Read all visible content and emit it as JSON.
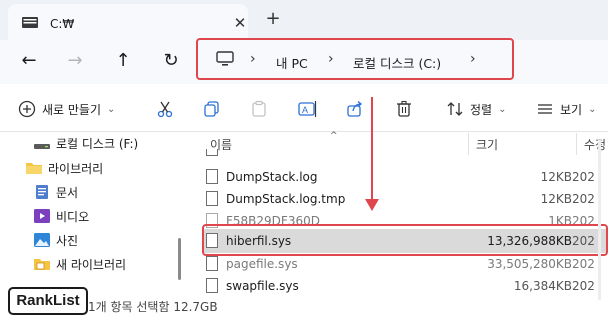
{
  "tab": {
    "title": "C:₩",
    "close_glyph": "✕",
    "new_tab_glyph": "+"
  },
  "nav": {
    "back": "←",
    "forward": "→",
    "up": "↑",
    "refresh": "↻"
  },
  "address": {
    "sep": "›",
    "crumbs": [
      "내 PC",
      "로컬 디스크 (C:)"
    ]
  },
  "toolbar": {
    "new_label": "새로 만들기",
    "sort_label": "정렬",
    "view_label": "보기",
    "chevron": "⌄"
  },
  "sidebar": {
    "items": [
      {
        "label": "로컬 디스크 (F:)",
        "icon": "drive-icon"
      },
      {
        "label": "라이브러리",
        "icon": "library-folder-icon"
      },
      {
        "label": "문서",
        "icon": "documents-icon"
      },
      {
        "label": "비디오",
        "icon": "videos-icon"
      },
      {
        "label": "사진",
        "icon": "pictures-icon"
      },
      {
        "label": "새 라이브러리",
        "icon": "new-library-icon"
      }
    ]
  },
  "columns": {
    "name": "이름",
    "size": "크기",
    "date": "수정"
  },
  "files": [
    {
      "name": "DumpStack.log",
      "size": "12KB",
      "date": "202"
    },
    {
      "name": "DumpStack.log.tmp",
      "size": "12KB",
      "date": "202"
    },
    {
      "name": "F58B29DF360D",
      "size": "1KB",
      "date": "202"
    },
    {
      "name": "hiberfil.sys",
      "size": "13,326,988KB",
      "date": "202"
    },
    {
      "name": "pagefile.sys",
      "size": "33,505,280KB",
      "date": "202"
    },
    {
      "name": "swapfile.sys",
      "size": "16,384KB",
      "date": "202"
    }
  ],
  "status": {
    "text": "1개 항목 선택함 12.7GB"
  },
  "badge": {
    "text": "RankList"
  },
  "colors": {
    "accent_red": "#e0474c",
    "selection": "#dadada"
  }
}
